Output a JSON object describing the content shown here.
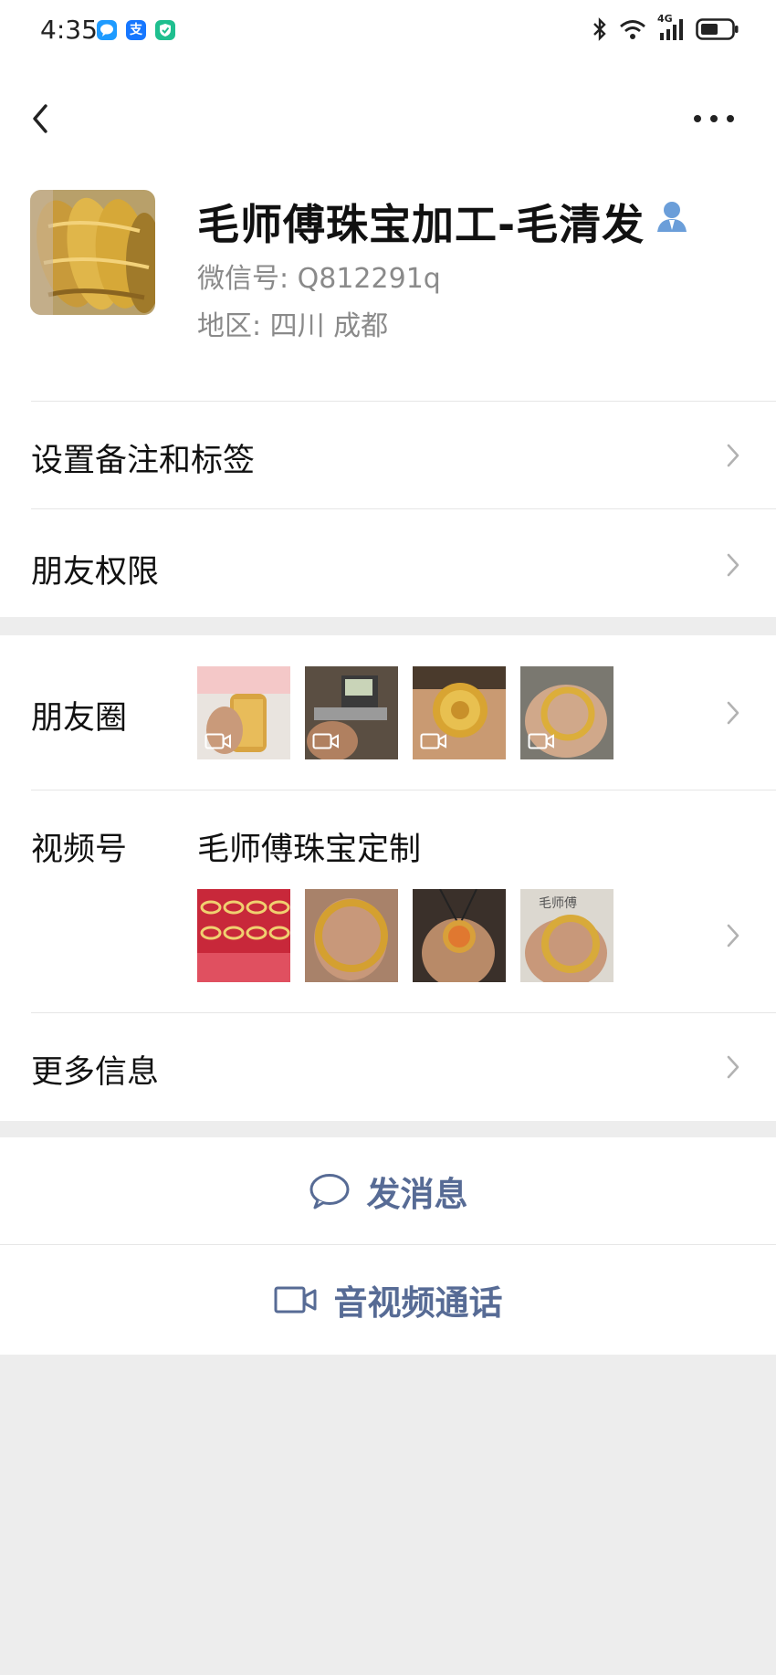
{
  "status_bar": {
    "time": "4:35",
    "left_icons": [
      "chat-app-icon",
      "alipay-icon",
      "shield-app-icon"
    ],
    "alipay_glyph": "支",
    "network": "4G",
    "right_icons": [
      "bluetooth-icon",
      "wifi-icon",
      "cellular-signal-icon",
      "battery-icon"
    ]
  },
  "nav": {
    "back_icon": "chevron-left-icon",
    "more_icon": "more-dots-icon"
  },
  "profile": {
    "name": "毛师傅珠宝加工-毛清发",
    "name_icon": "person-icon",
    "wechat_id": "微信号:  Q812291q",
    "region": "地区:  四川  成都"
  },
  "menu": {
    "remarks_label": "设置备注和标签",
    "permissions_label": "朋友权限",
    "moments_label": "朋友圈",
    "channels_label": "视频号",
    "channels_name": "毛师傅珠宝定制",
    "more_info_label": "更多信息"
  },
  "actions": {
    "message_label": "发消息",
    "message_icon": "chat-bubble-icon",
    "call_label": "音视频通话",
    "call_icon": "video-camera-icon"
  },
  "colors": {
    "accent": "#576b95",
    "background": "#ededed",
    "gold": "#d4a52a"
  }
}
